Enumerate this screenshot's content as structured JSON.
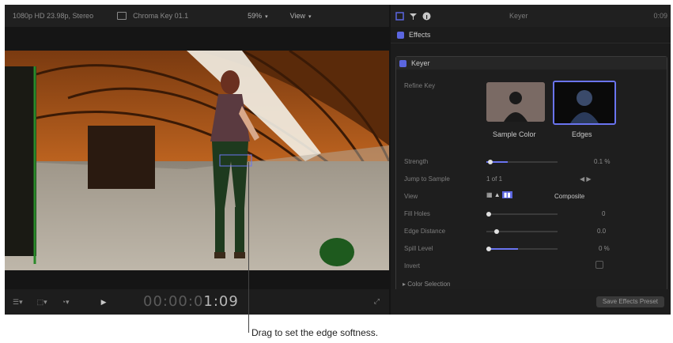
{
  "viewer": {
    "format": "1080p HD 23.98p, Stereo",
    "clip_name": "Chroma Key 01.1",
    "zoom": "59%",
    "view_menu": "View",
    "timecode_dim": "00:00:0",
    "timecode_bright": "1:09"
  },
  "inspector": {
    "title": "Keyer",
    "duration": "0:09",
    "effects_label": "Effects",
    "keyer_label": "Keyer",
    "refine_key_label": "Refine Key",
    "sample_color_label": "Sample Color",
    "edges_label": "Edges",
    "params": [
      {
        "label": "Strength",
        "value": "0.1 %",
        "fill": 0.3
      },
      {
        "label": "Jump to Sample",
        "value": "1 of 1"
      },
      {
        "label": "View",
        "value": "Composite"
      },
      {
        "label": "Fill Holes",
        "value": "0",
        "fill": 0.0
      },
      {
        "label": "Edge Distance",
        "value": "0.0",
        "fill": 0.1
      },
      {
        "label": "Spill Level",
        "value": "0 %",
        "fill": 0.45
      },
      {
        "label": "Invert",
        "value": ""
      }
    ],
    "color_selection_label": "Color Selection",
    "save_preset_label": "Save Effects Preset"
  },
  "caption": "Drag to set the edge softness."
}
